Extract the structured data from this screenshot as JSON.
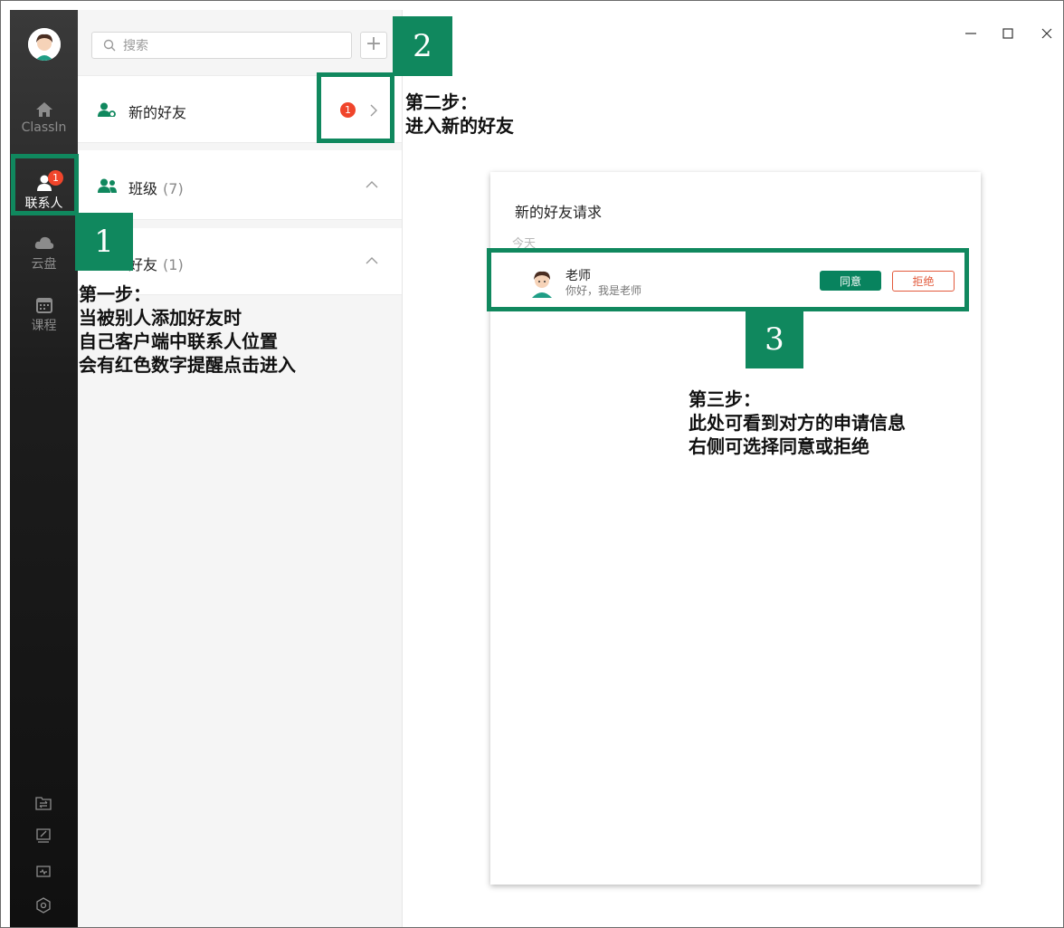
{
  "rail": {
    "items": [
      {
        "label": "ClassIn",
        "icon": "home-icon"
      },
      {
        "label": "联系人",
        "icon": "contacts-icon",
        "badge": "1"
      },
      {
        "label": "云盘",
        "icon": "cloud-icon"
      },
      {
        "label": "课程",
        "icon": "calendar-icon"
      }
    ],
    "tools": [
      "transfer-folder-icon",
      "whiteboard-icon",
      "monitor-icon",
      "settings-icon"
    ]
  },
  "contacts": {
    "search_placeholder": "搜索",
    "add_label": "+",
    "new_friends": {
      "label": "新的好友",
      "badge": "1"
    },
    "classes": {
      "label": "班级",
      "count": "(7)"
    },
    "friends": {
      "label": "好友",
      "count": "(1)"
    }
  },
  "window": {
    "minimize": "minimize-icon",
    "maximize": "maximize-icon",
    "close": "close-icon"
  },
  "dialog": {
    "title": "新的好友请求",
    "date_label": "今天",
    "request": {
      "name": "老师",
      "message": "你好，我是老师"
    },
    "agree_label": "同意",
    "reject_label": "拒绝"
  },
  "annotations": {
    "num1": "1",
    "num2": "2",
    "num3": "3",
    "step1": "第一步：\n当被别人添加好友时\n自己客户端中联系人位置\n会有红色数字提醒点击进入",
    "step2": "第二步：\n进入新的好友",
    "step3": "第三步：\n此处可看到对方的申请信息\n右侧可选择同意或拒绝"
  },
  "colors": {
    "accent": "#10885e",
    "badge": "#f0452b",
    "reject": "#e25a3c",
    "rail": "#1d1d1d"
  }
}
